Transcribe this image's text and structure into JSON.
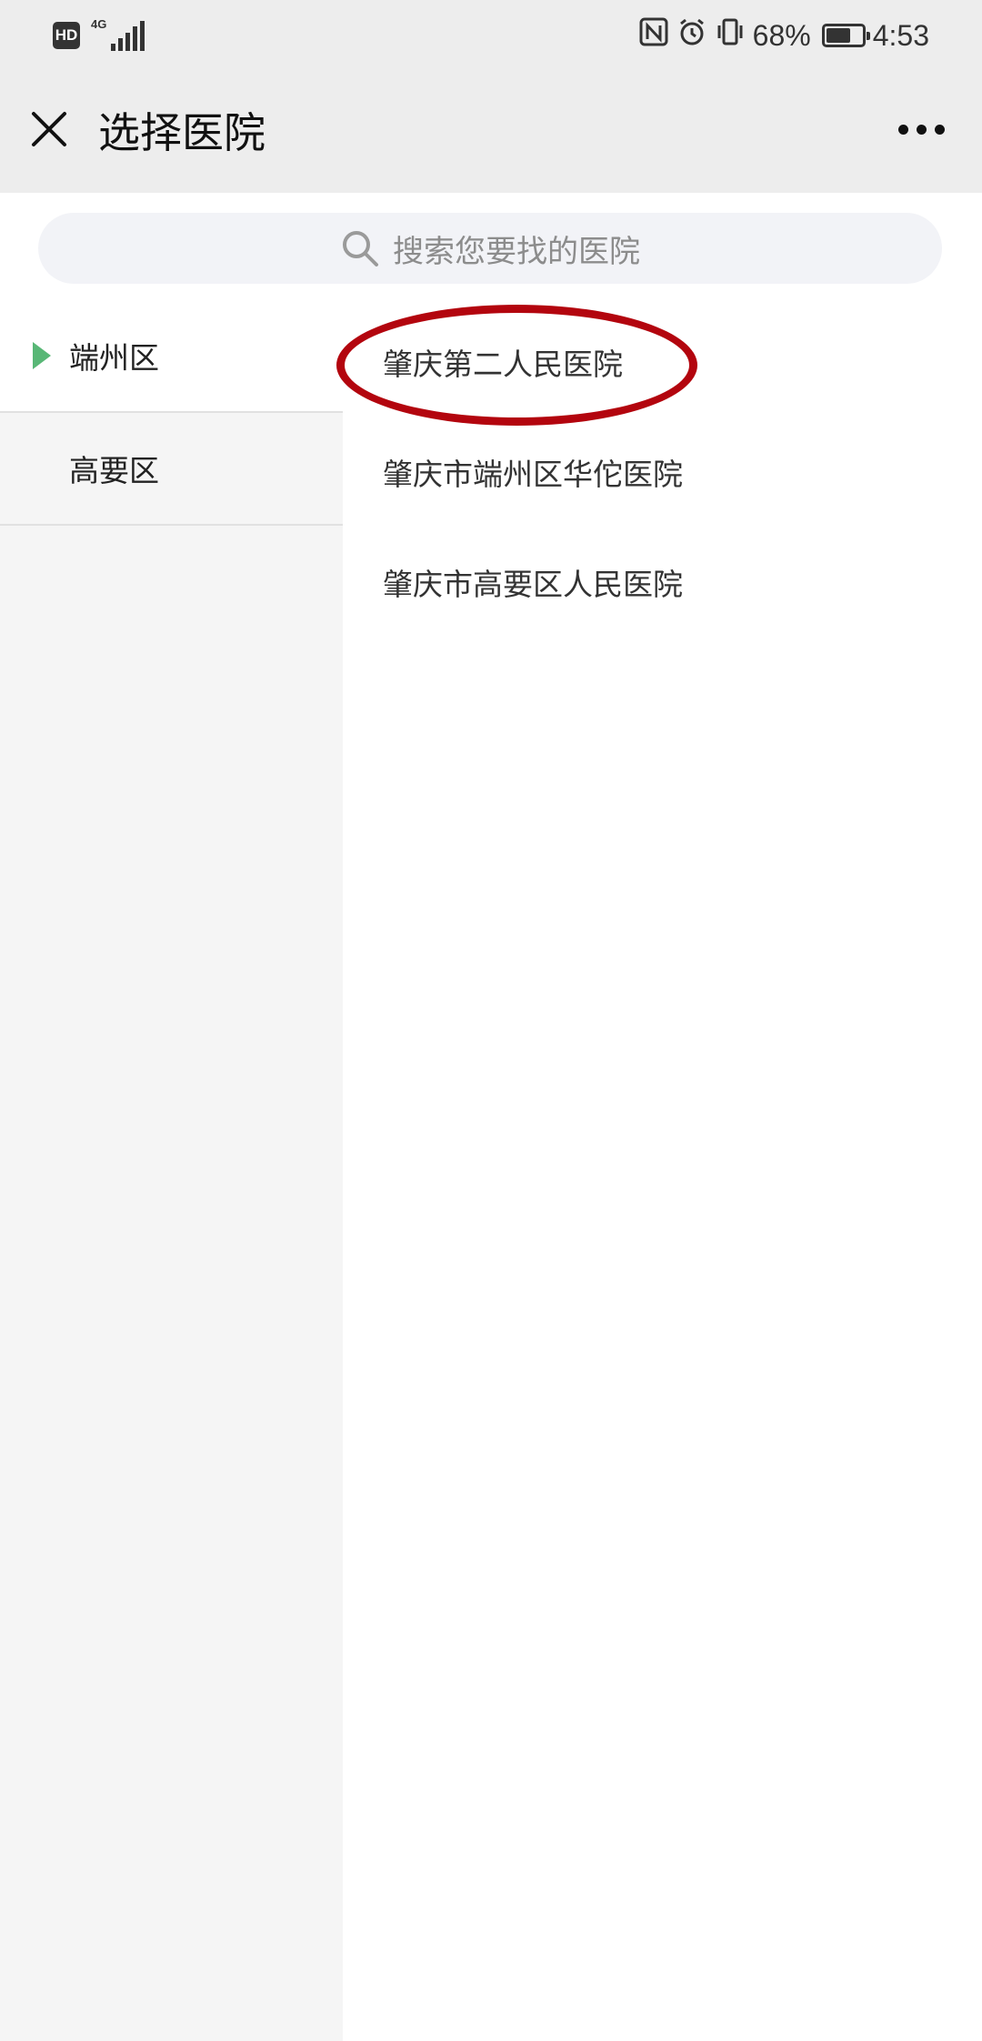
{
  "status_bar": {
    "hd": "HD",
    "network": "4G",
    "battery_percent": "68%",
    "battery_level": 0.68,
    "time": "4:53",
    "icons": [
      "nfc-icon",
      "alarm-icon",
      "vibrate-icon",
      "battery-icon"
    ]
  },
  "nav": {
    "title": "选择医院",
    "close_icon": "close-icon",
    "more_icon": "more-icon"
  },
  "search": {
    "placeholder": "搜索您要找的医院",
    "icon": "search-icon"
  },
  "districts": [
    {
      "label": "端州区",
      "selected": true
    },
    {
      "label": "高要区",
      "selected": false
    }
  ],
  "hospitals": [
    {
      "label": "肇庆第二人民医院"
    },
    {
      "label": "肇庆市端州区华佗医院"
    },
    {
      "label": "肇庆市高要区人民医院"
    }
  ],
  "colors": {
    "accent": "#58b776",
    "annotation": "#b3050e",
    "header_bg": "#ededed",
    "sidebar_bg": "#f5f5f5"
  }
}
